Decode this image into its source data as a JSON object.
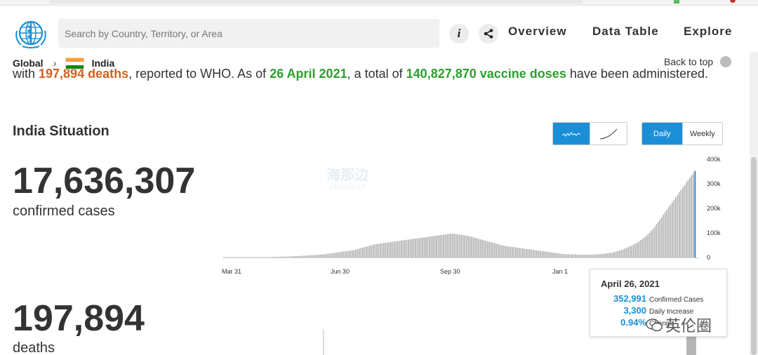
{
  "header": {
    "search_placeholder": "Search by Country, Territory, or Area",
    "info_label": "i",
    "nav": {
      "overview": "Overview",
      "data_table": "Data Table",
      "explore": "Explore"
    }
  },
  "breadcrumb": {
    "global": "Global",
    "country": "India",
    "back_to_top": "Back to top"
  },
  "sentence": {
    "prefix": "with ",
    "deaths": "197,894 deaths",
    "mid1": ", reported to WHO. As of ",
    "date": "26 April 2021",
    "mid2": ", a total of ",
    "doses": "140,827,870 vaccine doses",
    "suffix": " have been administered."
  },
  "situation": {
    "title": "India Situation",
    "confirmed_value": "17,636,307",
    "confirmed_label": "confirmed cases",
    "deaths_value": "197,894",
    "deaths_label": "deaths"
  },
  "toggles": {
    "daily": "Daily",
    "weekly": "Weekly",
    "active_period": "Daily",
    "active_chart": "bar"
  },
  "chart_data": {
    "type": "bar",
    "title": "",
    "xlabel": "",
    "ylabel": "",
    "x_ticks": [
      "Mar 31",
      "Jun 30",
      "Sep 30",
      "Jan 1"
    ],
    "y_ticks": [
      "0",
      "100k",
      "200k",
      "300k",
      "400k"
    ],
    "ylim": [
      0,
      400000
    ],
    "series": [
      {
        "values": [
          0,
          0,
          0,
          0,
          0,
          0,
          0,
          0,
          0,
          100,
          200,
          300,
          400,
          500,
          600,
          700,
          800,
          900,
          1000,
          1100,
          1200,
          1300,
          1400,
          1500,
          1600,
          1800,
          2000,
          2200,
          2400,
          2600,
          2800,
          3000,
          3200,
          3400,
          3600,
          3800,
          4000,
          4300,
          4600,
          4900,
          5200,
          5500,
          5800,
          6200,
          6600,
          7000,
          7500,
          8000,
          8500,
          9000,
          9500,
          10000,
          10500,
          11000,
          11500,
          12000,
          12500,
          13000,
          14000,
          15000,
          16000,
          17000,
          18000,
          19000,
          20000,
          21000,
          22000,
          23000,
          24000,
          25000,
          26000,
          27000,
          28000,
          29000,
          30000,
          32000,
          34000,
          36000,
          38000,
          40000,
          42000,
          44000,
          46000,
          48000,
          50000,
          52000,
          54000,
          55000,
          56000,
          57000,
          58000,
          59000,
          60000,
          61000,
          62000,
          63000,
          64000,
          65000,
          66000,
          67000,
          68000,
          69000,
          70000,
          71000,
          72000,
          73000,
          74000,
          75000,
          76000,
          77000,
          78000,
          79000,
          80000,
          81000,
          82000,
          83000,
          84000,
          85000,
          86000,
          87000,
          88000,
          89000,
          90000,
          91000,
          92000,
          93000,
          94000,
          95000,
          96000,
          97000,
          97000,
          96000,
          95000,
          94000,
          93000,
          92000,
          91000,
          90000,
          89000,
          88000,
          86000,
          84000,
          82000,
          80000,
          78000,
          76000,
          74000,
          72000,
          70000,
          68000,
          66000,
          64000,
          62000,
          60000,
          58000,
          56000,
          54000,
          52000,
          50000,
          48000,
          47000,
          46000,
          45000,
          44000,
          43000,
          42000,
          41000,
          40000,
          39000,
          38000,
          37000,
          36000,
          35000,
          34000,
          33000,
          32000,
          31000,
          30000,
          29000,
          28000,
          27000,
          26000,
          25000,
          24000,
          23000,
          22000,
          21000,
          20000,
          19000,
          18000,
          17000,
          16000,
          15000,
          14500,
          14000,
          13500,
          13000,
          12800,
          12600,
          12400,
          12200,
          12000,
          11800,
          11600,
          11400,
          11200,
          11000,
          11200,
          11400,
          11600,
          11800,
          12000,
          12500,
          13000,
          13500,
          14000,
          15000,
          16000,
          17000,
          18000,
          19000,
          20000,
          22000,
          24000,
          26000,
          28000,
          30000,
          33000,
          36000,
          39000,
          42000,
          45000,
          48000,
          52000,
          56000,
          60000,
          65000,
          70000,
          75000,
          81000,
          87000,
          93000,
          100000,
          108000,
          116000,
          125000,
          135000,
          145000,
          155000,
          165000,
          175000,
          185000,
          195000,
          205000,
          215000,
          225000,
          235000,
          245000,
          255000,
          265000,
          275000,
          285000,
          295000,
          305000,
          315000,
          325000,
          335000,
          345000,
          352991
        ]
      }
    ],
    "tooltip": {
      "date": "April 26, 2021",
      "confirmed": "352,991",
      "confirmed_label": "Confirmed Cases",
      "increase": "3,300",
      "increase_label": "Daily Increase",
      "change": "0.94%",
      "change_label": "Change"
    }
  },
  "colors": {
    "accent": "#1a8fd6",
    "bar": "#b5b5b5",
    "bar_highlight": "#1a8fd6",
    "deaths_text": "#d0611f",
    "date_text": "#2ca02c"
  },
  "watermark": {
    "text1": "海那边",
    "text2": "Hinabian",
    "badge": "英伦圈"
  }
}
